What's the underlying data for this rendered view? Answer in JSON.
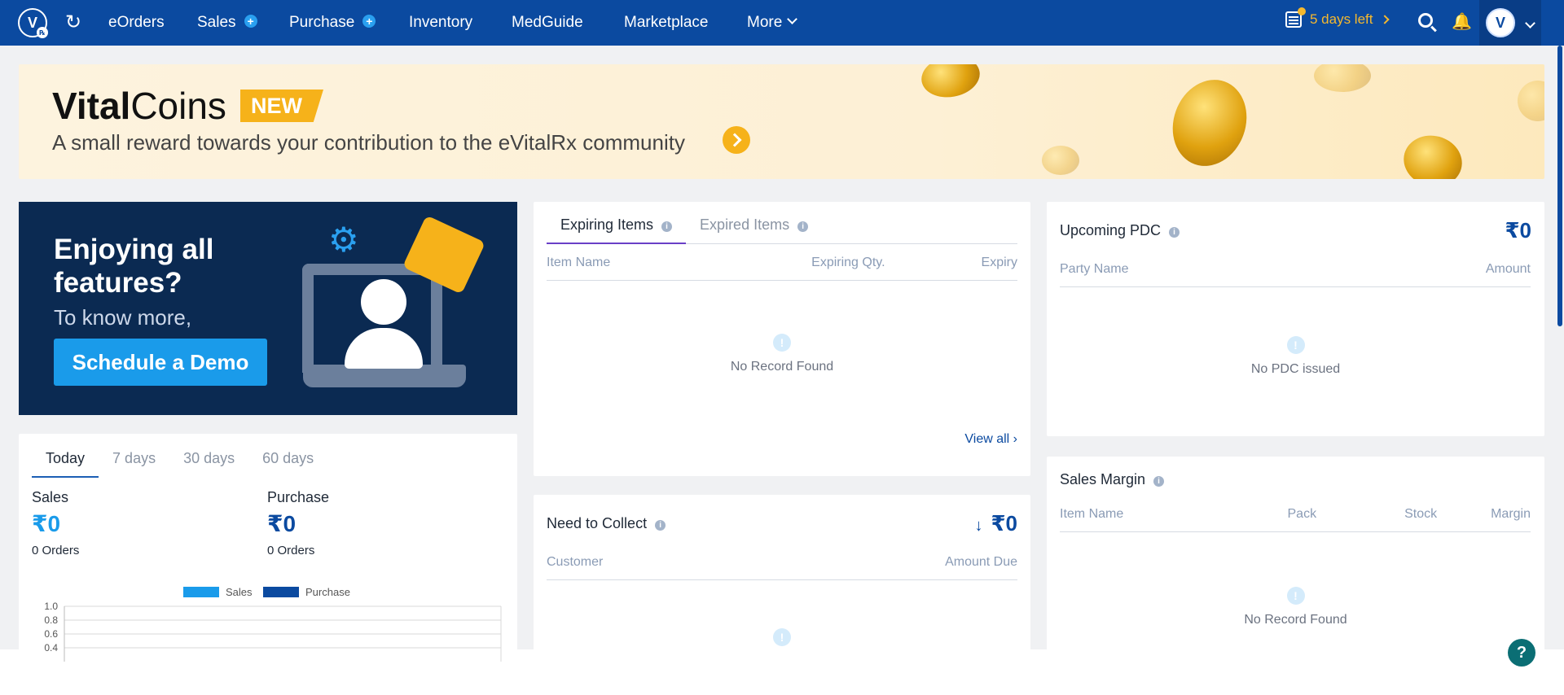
{
  "nav": {
    "logo_letter": "V",
    "items": [
      {
        "label": "eOrders"
      },
      {
        "label": "Sales"
      },
      {
        "label": "Purchase"
      },
      {
        "label": "Inventory"
      },
      {
        "label": "MedGuide"
      },
      {
        "label": "Marketplace"
      },
      {
        "label": "More"
      }
    ],
    "trial_text": "5 days left",
    "avatar_letter": "V",
    "icons": [
      "refresh-icon",
      "plus-icon",
      "chevron-down-icon",
      "calendar-icon",
      "search-icon",
      "bell-icon"
    ],
    "colors": {
      "bar": "#0b4aa0",
      "trial": "#f5b82e",
      "plus": "#2aa0f0"
    }
  },
  "banner": {
    "title_bold": "Vital",
    "title_rest": "Coins",
    "tag": "NEW",
    "subtitle": "A small reward towards your contribution to the eVitalRx community"
  },
  "demo": {
    "heading": "Enjoying all features?",
    "subtext": "To know more,",
    "button": "Schedule a Demo"
  },
  "summary": {
    "tabs": [
      "Today",
      "7 days",
      "30 days",
      "60 days"
    ],
    "active_tab": "Today",
    "sales_label": "Sales",
    "sales_value": "₹0",
    "sales_orders": "0 Orders",
    "purchase_label": "Purchase",
    "purchase_value": "₹0",
    "purchase_orders": "0 Orders",
    "legend": [
      "Sales",
      "Purchase"
    ],
    "yticks": [
      "1.0",
      "0.8",
      "0.6",
      "0.4"
    ]
  },
  "expiring": {
    "tabs": [
      "Expiring Items",
      "Expired Items"
    ],
    "columns": [
      "Item Name",
      "Expiring Qty.",
      "Expiry"
    ],
    "empty": "No Record Found",
    "view_all": "View all"
  },
  "collect": {
    "title": "Need to Collect",
    "amount": "₹0",
    "columns": [
      "Customer",
      "Amount Due"
    ]
  },
  "pdc": {
    "title": "Upcoming PDC",
    "amount": "₹0",
    "columns": [
      "Party Name",
      "Amount"
    ],
    "empty": "No PDC issued"
  },
  "margin": {
    "title": "Sales Margin",
    "columns": [
      "Item Name",
      "Pack",
      "Stock",
      "Margin"
    ],
    "empty": "No Record Found"
  },
  "chart_data": {
    "type": "bar",
    "categories": [],
    "series": [
      {
        "name": "Sales",
        "values": []
      },
      {
        "name": "Purchase",
        "values": []
      }
    ],
    "ylim": [
      0.4,
      1.0
    ],
    "title": "",
    "xlabel": "",
    "ylabel": "",
    "legend": "top"
  }
}
